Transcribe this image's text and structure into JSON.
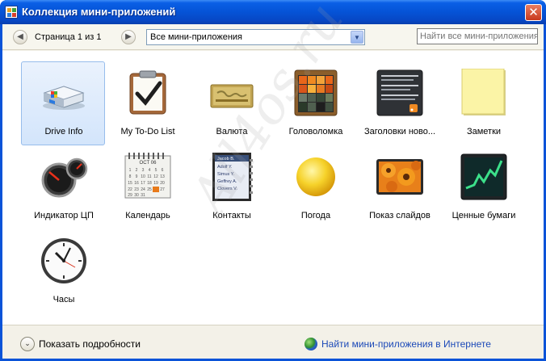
{
  "window": {
    "title": "Коллекция мини-приложений",
    "close_label": "✕"
  },
  "toolbar": {
    "prev_icon": "chevron-left",
    "next_icon": "chevron-right",
    "prev_glyph": "◀",
    "next_glyph": "▶",
    "page_text": "Страница 1 из 1",
    "category_value": "Все мини-приложения",
    "category_arrow": "▼",
    "search_placeholder": "Найти все мини-приложения"
  },
  "gadgets": [
    {
      "label": "Drive Info",
      "icon": "drive-info-icon",
      "selected": true
    },
    {
      "label": "My To-Do List",
      "icon": "todo-list-icon",
      "selected": false
    },
    {
      "label": "Валюта",
      "icon": "currency-icon",
      "selected": false
    },
    {
      "label": "Головоломка",
      "icon": "puzzle-icon",
      "selected": false
    },
    {
      "label": "Заголовки ново...",
      "icon": "news-headlines-icon",
      "selected": false
    },
    {
      "label": "Заметки",
      "icon": "notes-icon",
      "selected": false
    },
    {
      "label": "Индикатор ЦП",
      "icon": "cpu-meter-icon",
      "selected": false
    },
    {
      "label": "Календарь",
      "icon": "calendar-icon",
      "selected": false
    },
    {
      "label": "Контакты",
      "icon": "contacts-icon",
      "selected": false
    },
    {
      "label": "Погода",
      "icon": "weather-icon",
      "selected": false
    },
    {
      "label": "Показ слайдов",
      "icon": "slideshow-icon",
      "selected": false
    },
    {
      "label": "Ценные бумаги",
      "icon": "stocks-icon",
      "selected": false
    },
    {
      "label": "Часы",
      "icon": "clock-icon",
      "selected": false
    }
  ],
  "calendar_icon": {
    "month": "OCT 06"
  },
  "contacts_icon": {
    "names": [
      "Jacob B.",
      "Adolf Y.",
      "Simus Y.",
      "Geffrey A.",
      "Clovers V."
    ]
  },
  "watermark": "All4os.ru",
  "footer": {
    "details_glyph": "⌄",
    "details_label": "Показать подробности",
    "online_link": "Найти мини-приложения в Интернете"
  },
  "colors": {
    "titlebar": "#0553d6",
    "selection": "#d3e5fb",
    "link": "#1b49b8"
  }
}
